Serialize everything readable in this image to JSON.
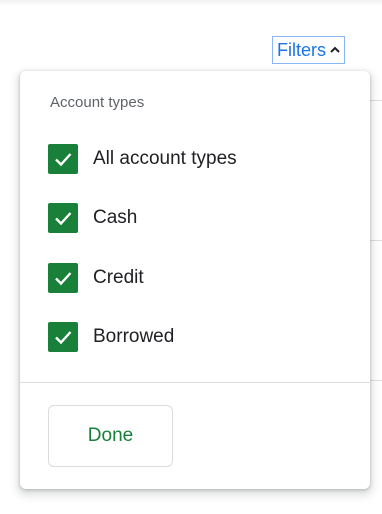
{
  "header": {
    "filters_label": "Filters",
    "filters_icon": "chevron-up-icon"
  },
  "filter_panel": {
    "section_label": "Account types",
    "options": [
      {
        "label": "All account types",
        "checked": true
      },
      {
        "label": "Cash",
        "checked": true
      },
      {
        "label": "Credit",
        "checked": true
      },
      {
        "label": "Borrowed",
        "checked": true
      }
    ],
    "done_label": "Done"
  },
  "colors": {
    "accent_green": "#188038",
    "link_blue": "#1a73e8",
    "toggle_border": "#8ab4f8",
    "muted_text": "#5f6368",
    "divider": "#dadce0"
  }
}
